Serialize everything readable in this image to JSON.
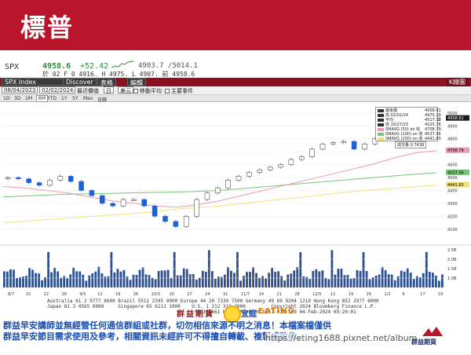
{
  "header": {
    "title": "標普"
  },
  "quote": {
    "symbol": "SPX",
    "last": "4958.6",
    "change": "+52.42",
    "bid_ask": "4903.7 /5014.1",
    "row2": "於 02 F 0 4916. H 4975. L 4907. 前 4958.6"
  },
  "toolbar": {
    "index_name": "SPX Index",
    "discover": "Discover",
    "table": "表格",
    "edit": "編輯",
    "k_chart": "K線圖"
  },
  "controls": {
    "start_date": "08/04/2023",
    "end_date": "02/02/2024",
    "period_label": "最近價值",
    "period": "日",
    "currency": "美元",
    "opt_moving_avg": "移動平均",
    "opt_events": "主要事件"
  },
  "range_tabs": [
    "1D",
    "3D",
    "1M",
    "6M",
    "YTD",
    "1Y",
    "5Y",
    "Max",
    "日線"
  ],
  "chart_data": {
    "type": "line",
    "series_type": "candlestick",
    "yaxis_ticks": [
      4100,
      4200,
      4300,
      4400,
      4500,
      4600,
      4700,
      4800,
      4900,
      5000
    ],
    "y_badges": [
      {
        "label": "4958.61",
        "color": "#ffffff"
      },
      {
        "label": "4708.79",
        "color": "#e89ab6"
      },
      {
        "label": "4537.56",
        "color": "#7ac47a"
      },
      {
        "label": "4441.83",
        "color": "#f0e27a"
      }
    ],
    "xaxis_labels": [
      "8/7",
      "15",
      "22",
      "29",
      "9/5",
      "12",
      "19",
      "26",
      "10/3",
      "10",
      "17",
      "24",
      "31",
      "11/7",
      "14",
      "21",
      "28",
      "12/5",
      "12",
      "19",
      "26",
      "1/2",
      "9",
      "17",
      "23"
    ],
    "close_points": [
      4500,
      4490,
      4460,
      4440,
      4480,
      4510,
      4470,
      4400,
      4360,
      4300,
      4280,
      4330,
      4330,
      4280,
      4200,
      4160,
      4120,
      4200,
      4330,
      4380,
      4420,
      4480,
      4510,
      4540,
      4560,
      4580,
      4600,
      4640,
      4660,
      4720,
      4760,
      4770,
      4780,
      4720,
      4760,
      4800,
      4850,
      4870,
      4900,
      4930,
      4950,
      4958
    ],
    "sma50": [
      4430,
      4420,
      4400,
      4380,
      4350,
      4320,
      4300,
      4280,
      4270,
      4290,
      4320,
      4360,
      4400,
      4440,
      4480,
      4520,
      4560,
      4600,
      4650,
      4690,
      4708
    ],
    "sma100": [
      4350,
      4360,
      4370,
      4375,
      4380,
      4385,
      4390,
      4400,
      4420,
      4440,
      4460,
      4480,
      4500,
      4520,
      4537
    ],
    "sma200": [
      4150,
      4170,
      4190,
      4210,
      4230,
      4260,
      4280,
      4310,
      4340,
      4370,
      4400,
      4420,
      4441
    ],
    "volume_ticks": [
      "2.5B",
      "2.0B",
      "1.5B",
      "1.0B"
    ]
  },
  "legend": {
    "rows": [
      {
        "label": "最後價",
        "value": "4958.61",
        "color": "#333333"
      },
      {
        "label": "高 02/02/24",
        "value": "4975.29",
        "color": "#333333"
      },
      {
        "label": "平均",
        "value": "4517.12",
        "color": "#333333"
      },
      {
        "label": "低 10/27/23",
        "value": "4103.78",
        "color": "#333333"
      },
      {
        "label": "SMAVG (50) on 收",
        "value": "4708.79",
        "color": "#e89ab6"
      },
      {
        "label": "SMAVG (100) on 收",
        "value": "4537.56",
        "color": "#7ac47a"
      },
      {
        "label": "SMAVG (200) on 收",
        "value": "4441.83",
        "color": "#f0e27a"
      }
    ],
    "volume": "成交量 0.743B"
  },
  "footer_src": {
    "line1": "Australia 61 2 9777 8600 Brazil 5511 2395 9000 Europe 44 20 7330 7500 Germany 49 69 9204 1210 Hong Kong 852 2977 6000",
    "line2": "Japan 81 3 4565 8900     Singapore 65 6212 1000    U.S. 1 212 318 2000         Copyright 2024 Bloomberg Finance L.P.",
    "line3": "                                                    SN 128661 MKT  GMT+8:00 G511-919-169 04-Feb-2024 09:20:01"
  },
  "disclaimer": {
    "line1": "群益早安講師並無經營任何通信群組或社群，切勿相信來源不明之消息！本檔案檔僅供",
    "line2": "群益早安節目需求使用及參考，相關資訊未經許可不得擅自轉載、複製或散佈。"
  },
  "mid_logo": {
    "text1": "群益期貨",
    "text2": "宜庭",
    "text3": "EATING"
  },
  "url": "https://eting1688.pixnet.net/album",
  "brand": {
    "name": "群益期貨"
  }
}
